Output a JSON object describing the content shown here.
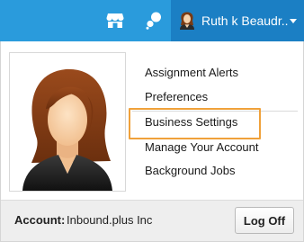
{
  "header": {
    "user_name": "Ruth k Beaudr..",
    "icons": {
      "store": "store-icon",
      "chat": "chat-icon",
      "avatar": "user-avatar-icon",
      "caret": "chevron-down-icon"
    },
    "colors": {
      "bar": "#2a9bdc",
      "user_segment": "#1b7fc4"
    }
  },
  "menu": {
    "items": [
      {
        "label": "Assignment Alerts"
      },
      {
        "label": "Preferences"
      },
      {
        "label": "Business Settings",
        "highlighted": true
      },
      {
        "label": "Manage Your Account"
      },
      {
        "label": "Background Jobs"
      }
    ],
    "highlight_color": "#f0a13a"
  },
  "footer": {
    "account_label": "Account:",
    "account_value": "Inbound.plus Inc",
    "logoff_label": "Log Off"
  }
}
